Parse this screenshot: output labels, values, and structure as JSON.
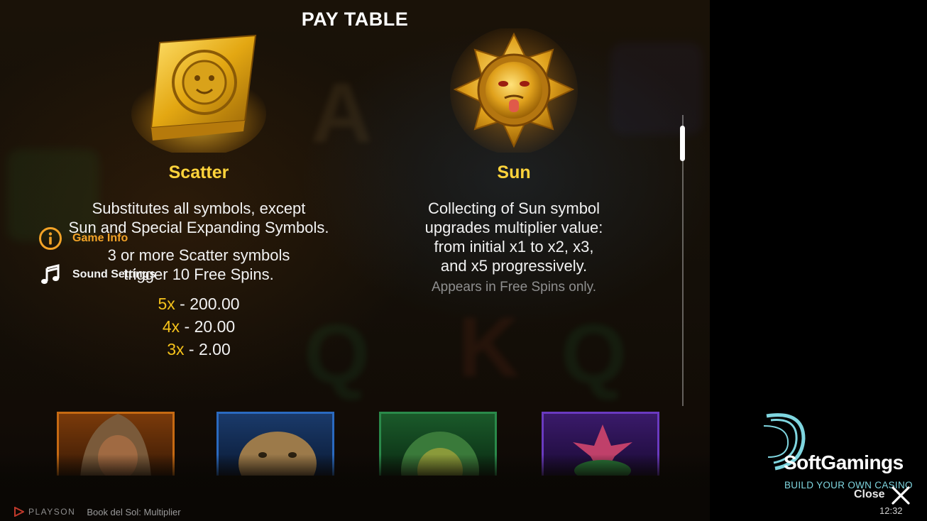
{
  "header": {
    "title": "PAY TABLE"
  },
  "scatter": {
    "name": "Scatter",
    "description_lines": [
      "Substitutes all symbols, except",
      "Sun and Special Expanding Symbols."
    ],
    "trigger_lines": [
      "3 or more Scatter symbols",
      "trigger 10 Free Spins."
    ],
    "payouts": [
      {
        "multiplier": "5x",
        "value": "200.00"
      },
      {
        "multiplier": "4x",
        "value": "20.00"
      },
      {
        "multiplier": "3x",
        "value": "2.00"
      }
    ],
    "icon": "golden-book-icon"
  },
  "sun": {
    "name": "Sun",
    "description_lines": [
      "Collecting of Sun symbol",
      "upgrades multiplier value:",
      "from initial x1 to x2, x3,",
      "and x5 progressively."
    ],
    "note": "Appears in Free Spins only.",
    "icon": "golden-sun-icon"
  },
  "side_menu": {
    "items": [
      {
        "label": "Game Info",
        "icon": "info-icon",
        "active": true
      },
      {
        "label": "Sound Settings",
        "icon": "music-note-icon",
        "active": false
      }
    ]
  },
  "footer": {
    "provider": "PLAYSON",
    "game_name": "Book del Sol: Multiplier"
  },
  "watermark": {
    "name": "SoftGamings",
    "tagline": "BUILD YOUR OWN CASINO"
  },
  "close": {
    "label": "Close"
  },
  "clock": "12:32",
  "colors": {
    "accent_gold": "#ffd33b",
    "menu_active": "#f2a227",
    "note_gray": "#8f8f8f"
  }
}
